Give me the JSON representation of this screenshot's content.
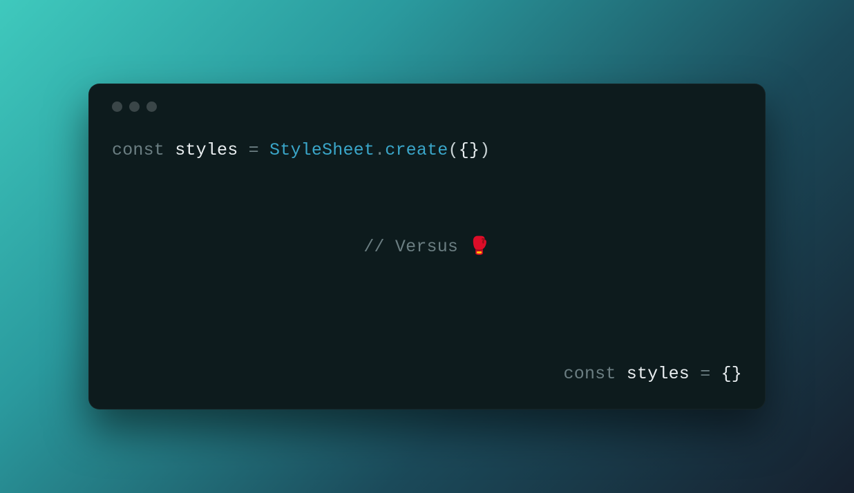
{
  "code": {
    "line1": {
      "keyword": "const",
      "ident": "styles",
      "op": "=",
      "class": "StyleSheet",
      "dot": ".",
      "method": "create",
      "open_paren": "(",
      "open_brace": "{",
      "close_brace": "}",
      "close_paren": ")"
    },
    "comment": {
      "slashes": "//",
      "text": "Versus",
      "emoji": "🥊"
    },
    "line3": {
      "keyword": "const",
      "ident": "styles",
      "op": "=",
      "open_brace": "{",
      "close_brace": "}"
    }
  }
}
